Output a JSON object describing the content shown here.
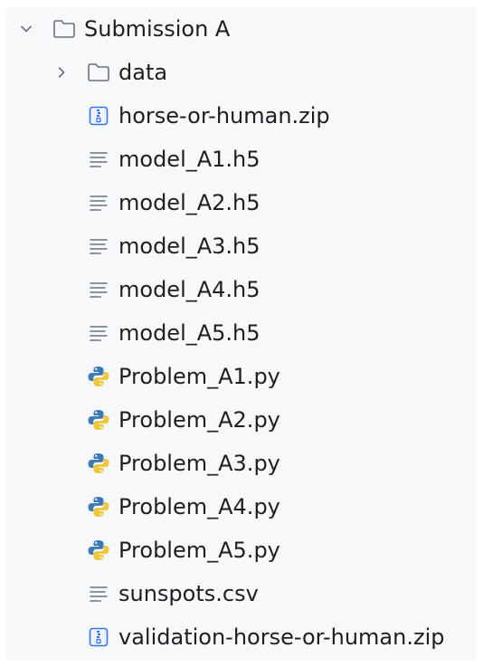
{
  "tree": {
    "root": {
      "label": "Submission A",
      "expanded": true,
      "icon": "folder-icon"
    },
    "items": [
      {
        "label": "data",
        "icon": "folder-icon",
        "expandable": true,
        "expanded": false
      },
      {
        "label": "horse-or-human.zip",
        "icon": "zip-archive-icon"
      },
      {
        "label": "model_A1.h5",
        "icon": "text-file-icon"
      },
      {
        "label": "model_A2.h5",
        "icon": "text-file-icon"
      },
      {
        "label": "model_A3.h5",
        "icon": "text-file-icon"
      },
      {
        "label": "model_A4.h5",
        "icon": "text-file-icon"
      },
      {
        "label": "model_A5.h5",
        "icon": "text-file-icon"
      },
      {
        "label": "Problem_A1.py",
        "icon": "python-file-icon"
      },
      {
        "label": "Problem_A2.py",
        "icon": "python-file-icon"
      },
      {
        "label": "Problem_A3.py",
        "icon": "python-file-icon"
      },
      {
        "label": "Problem_A4.py",
        "icon": "python-file-icon"
      },
      {
        "label": "Problem_A5.py",
        "icon": "python-file-icon"
      },
      {
        "label": "sunspots.csv",
        "icon": "text-file-icon"
      },
      {
        "label": "validation-horse-or-human.zip",
        "icon": "zip-archive-icon"
      }
    ]
  },
  "colors": {
    "panel_background": "#f7f8fa",
    "text": "#1e1f22",
    "icon_gray": "#6c707e",
    "zip_blue": "#3574f0",
    "python_blue": "#3d7ab8",
    "python_yellow": "#f2c53d"
  }
}
